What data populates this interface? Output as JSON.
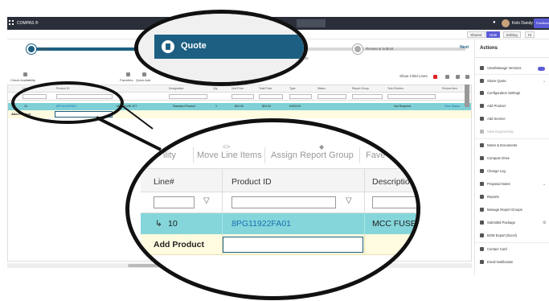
{
  "topbar": {
    "app_name": "COMPAS ®",
    "user_name": "Kelo Dandy",
    "feedback_label": "Feedback"
  },
  "subbar": {
    "share_label": "Shared",
    "hide_label": "Hide",
    "editing_label": "Editing",
    "view_label": "Hi"
  },
  "stepper": {
    "step1": "Quote",
    "step2": "Quote",
    "step3": "Review & Submit",
    "next_label": "Next",
    "line_tab": "LINE"
  },
  "toolbar_small": {
    "check_availability": "Check Availability",
    "favorites": "Favorites",
    "quick_add": "Quick Add",
    "show_child_lines": "Show Child Lines"
  },
  "grid_small": {
    "headers": [
      "Line#",
      "Product ID",
      "Designation",
      "Qty",
      "Unit Price",
      "Total Price",
      "Type",
      "Status",
      "Report Group",
      "Tech Review",
      "Review Item"
    ],
    "row": {
      "line": "10",
      "product_id": "8PG11922FA01",
      "desc": "MCC FUSE KIT",
      "standard": "Standard Product",
      "qty": "1",
      "unit": "$24.00",
      "total": "$24.00",
      "type": "INS/SVS",
      "review": "Not Required",
      "view": "View Status"
    },
    "add_product": "Add Product"
  },
  "zoom": {
    "toolbar": {
      "partial_label": "ility",
      "move_line_items": "Move Line Items",
      "assign_report_group": "Assign Report Group",
      "favorites_partial": "Fave"
    },
    "columns": {
      "line": "Line#",
      "product_id": "Product ID",
      "description_partial": "Descriptio"
    },
    "row": {
      "line_arrow": "↳",
      "line": "10",
      "product_id": "8PG11922FA01",
      "desc": "MCC FUSE KIT"
    },
    "add_product": "Add Product",
    "quote_pill": "Quote"
  },
  "sidebar": {
    "title": "Actions",
    "items": [
      {
        "label": "View/Manage Versions"
      },
      {
        "label": "Share Quote"
      },
      {
        "label": "Configuration Settings"
      },
      {
        "label": "Add Product"
      },
      {
        "label": "Add Service"
      },
      {
        "label": "View Engineering"
      },
      {
        "label": "Notes & Documents"
      },
      {
        "label": "Compute Drive"
      },
      {
        "label": "Change Log"
      },
      {
        "label": "Proposal Notes"
      },
      {
        "label": "Reports"
      },
      {
        "label": "Manage Report Groups"
      },
      {
        "label": "Submittal Package"
      },
      {
        "label": "BOM Export (Excel)"
      },
      {
        "label": "Contact Card"
      },
      {
        "label": "Email Notification"
      }
    ]
  },
  "colors": {
    "brand": "#1c5f82",
    "row_highlight": "#84d6db",
    "add_row": "#fffbe0",
    "link": "#1a6fb0"
  }
}
